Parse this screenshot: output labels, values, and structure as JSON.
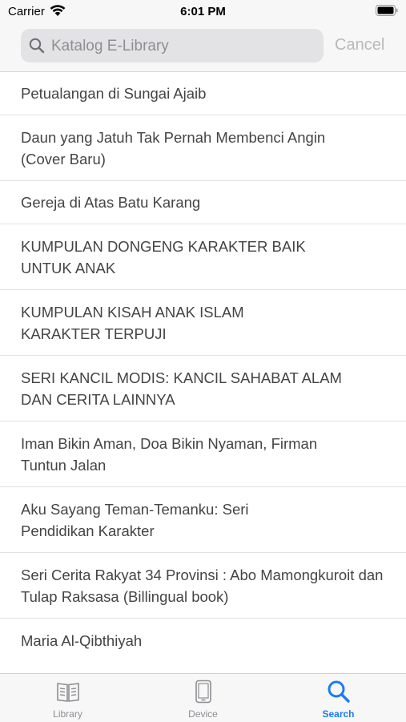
{
  "status_bar": {
    "carrier": "Carrier",
    "time": "6:01 PM"
  },
  "search": {
    "placeholder": "Katalog E-Library",
    "value": "",
    "cancel_label": "Cancel"
  },
  "results": [
    "Petualangan di Sungai Ajaib",
    "Daun yang Jatuh Tak Pernah Membenci Angin (Cover Baru)",
    "Gereja di Atas Batu Karang",
    "KUMPULAN DONGENG KARAKTER BAIK UNTUK ANAK",
    "KUMPULAN KISAH ANAK ISLAM KARAKTER TERPUJI",
    "SERI KANCIL MODIS: KANCIL SAHABAT ALAM DAN CERITA LAINNYA",
    "Iman Bikin Aman, Doa Bikin Nyaman, Firman Tuntun Jalan",
    "Aku Sayang Teman-Temanku: Seri Pendidikan Karakter",
    "Seri Cerita Rakyat 34 Provinsi : Abo Mamongkuroit dan Tulap Raksasa (Billingual book)",
    "Maria Al-Qibthiyah"
  ],
  "tabs": [
    {
      "label": "Library",
      "icon": "book-icon",
      "active": false
    },
    {
      "label": "Device",
      "icon": "phone-icon",
      "active": false
    },
    {
      "label": "Search",
      "icon": "search-icon",
      "active": true
    }
  ],
  "colors": {
    "accent": "#1a7cf5",
    "inactive": "#8e8e93"
  }
}
